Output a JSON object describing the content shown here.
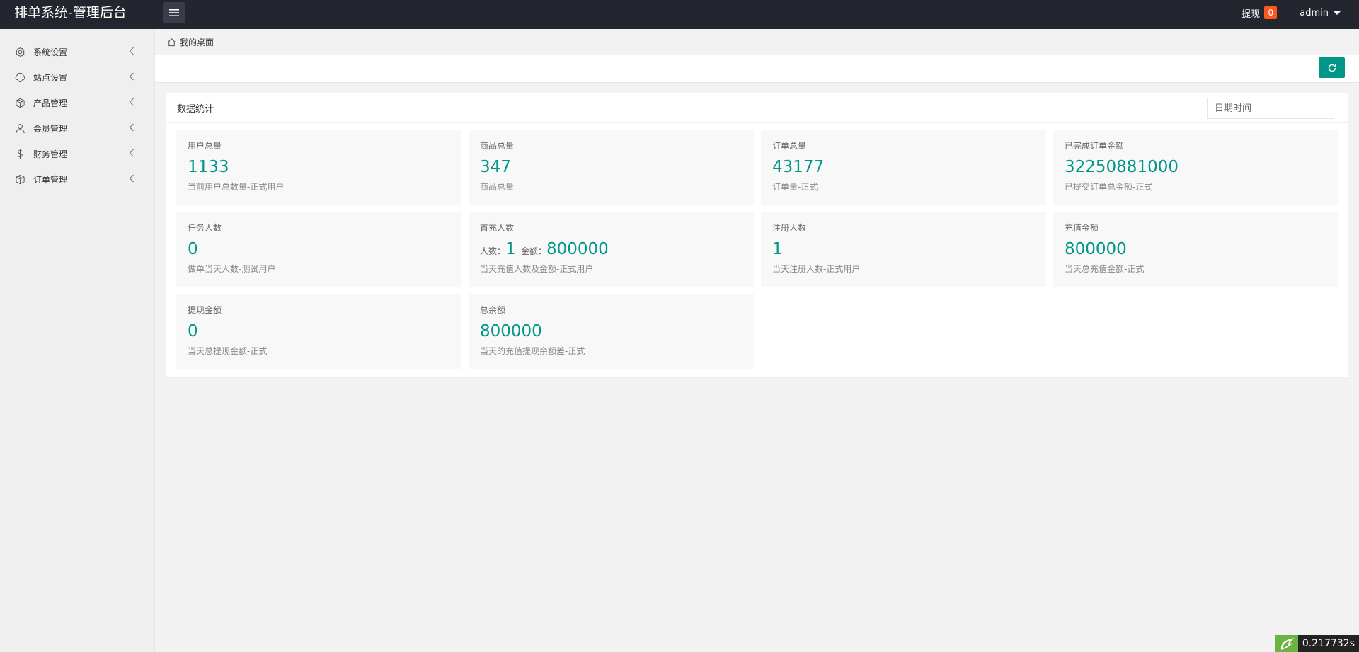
{
  "header": {
    "title": "排单系统-管理后台",
    "withdraw_label": "提现",
    "withdraw_count": "0",
    "user": "admin"
  },
  "sidebar": {
    "items": [
      {
        "label": "系统设置",
        "icon": "gear-icon"
      },
      {
        "label": "站点设置",
        "icon": "site-icon"
      },
      {
        "label": "产品管理",
        "icon": "box-icon"
      },
      {
        "label": "会员管理",
        "icon": "user-icon"
      },
      {
        "label": "财务管理",
        "icon": "dollar-icon"
      },
      {
        "label": "订单管理",
        "icon": "box-icon"
      }
    ]
  },
  "breadcrumb": {
    "label": "我的桌面"
  },
  "panel": {
    "title": "数据统计",
    "date_placeholder": "日期时间"
  },
  "stats": [
    {
      "title": "用户总量",
      "value": "1133",
      "desc": "当前用户总数量-正式用户"
    },
    {
      "title": "商品总量",
      "value": "347",
      "desc": "商品总量"
    },
    {
      "title": "订单总量",
      "value": "43177",
      "desc": "订单量-正式"
    },
    {
      "title": "已完成订单金额",
      "value": "32250881000",
      "desc": "已提交订单总金额-正式"
    },
    {
      "title": "任务人数",
      "value": "0",
      "desc": "做单当天人数-测试用户"
    },
    {
      "title": "首充人数",
      "people_label": "人数：",
      "people_value": "1",
      "amount_label": "金额：",
      "amount_value": "800000",
      "desc": "当天充值人数及金额-正式用户"
    },
    {
      "title": "注册人数",
      "value": "1",
      "desc": "当天注册人数-正式用户"
    },
    {
      "title": "充值金额",
      "value": "800000",
      "desc": "当天总充值金额-正式"
    },
    {
      "title": "提现金额",
      "value": "0",
      "desc": "当天总提现金额-正式"
    },
    {
      "title": "总余额",
      "value": "800000",
      "desc": "当天的充值提现余额差-正式"
    }
  ],
  "timer": {
    "value": "0.217732s"
  },
  "colors": {
    "accent": "#009688",
    "header_bg": "#23262e",
    "badge": "#ff5722"
  }
}
